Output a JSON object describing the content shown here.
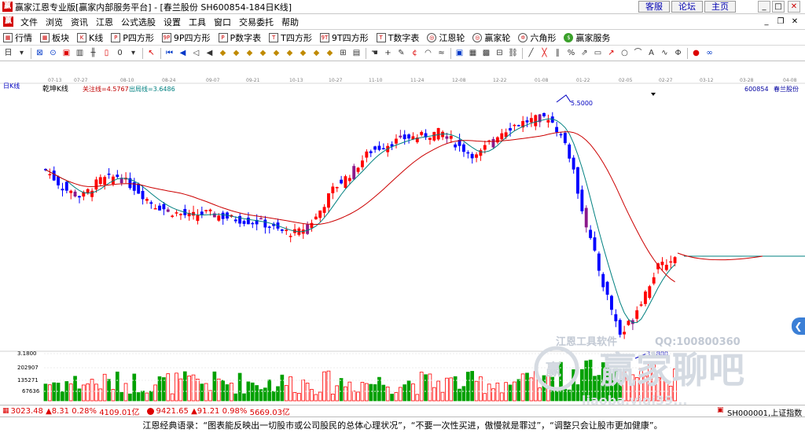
{
  "window": {
    "app_icon": "赢",
    "title": "赢家江恩专业版[赢家内部服务平台] - [春兰股份  SH600854-184日K线]",
    "links": [
      "客服",
      "论坛",
      "主页"
    ],
    "controls": [
      "minimize-icon",
      "maximize-icon",
      "close-icon"
    ]
  },
  "menubar": {
    "logo": "赢",
    "items": [
      "文件",
      "浏览",
      "资讯",
      "江恩",
      "公式选股",
      "设置",
      "工具",
      "窗口",
      "交易委托",
      "帮助"
    ],
    "mdi_controls": [
      "minimize-icon",
      "restore-icon",
      "close-icon"
    ]
  },
  "toolbar1": {
    "items": [
      {
        "label": "行情",
        "icon": "grid-icon",
        "ico": "▦"
      },
      {
        "label": "板块",
        "icon": "blocks-icon",
        "ico": "▦"
      },
      {
        "label": "K线",
        "icon": "candlestick-icon",
        "ico": "K"
      },
      {
        "label": "P四方形",
        "icon": "p-square-icon",
        "ico": "P"
      },
      {
        "label": "9P四方形",
        "icon": "9p-square-icon",
        "ico": "9P"
      },
      {
        "label": "P数字表",
        "icon": "p-number-table-icon",
        "ico": "P"
      },
      {
        "label": "T四方形",
        "icon": "t-square-icon",
        "ico": "T"
      },
      {
        "label": "9T四方形",
        "icon": "9t-square-icon",
        "ico": "9T"
      },
      {
        "label": "T数字表",
        "icon": "t-number-table-icon",
        "ico": "T"
      },
      {
        "label": "江恩轮",
        "icon": "gann-wheel-icon",
        "ico": "◎"
      },
      {
        "label": "赢家轮",
        "icon": "winner-wheel-icon",
        "ico": "◎"
      },
      {
        "label": "六角形",
        "icon": "hexagon-icon",
        "ico": "✡"
      },
      {
        "label": "赢家服务",
        "icon": "dollar-icon",
        "ico": "$"
      }
    ]
  },
  "toolbar2": {
    "icons": [
      {
        "name": "period-icon",
        "glyph": "日",
        "color": ""
      },
      {
        "name": "dropdown-icon",
        "glyph": "▾",
        "color": ""
      },
      {
        "name": "sep",
        "glyph": "",
        "color": ""
      },
      {
        "name": "diamond-icon",
        "glyph": "⊠",
        "color": "blue"
      },
      {
        "name": "circle-icon",
        "glyph": "⊙",
        "color": "blue"
      },
      {
        "name": "square-icon",
        "glyph": "▣",
        "color": "red"
      },
      {
        "name": "bar-icon",
        "glyph": "▥",
        "color": ""
      },
      {
        "name": "line-icon",
        "glyph": "╫",
        "color": ""
      },
      {
        "name": "candle-icon",
        "glyph": "▯",
        "color": "red"
      },
      {
        "name": "scale-icon",
        "glyph": "0",
        "color": ""
      },
      {
        "name": "dropdown-icon",
        "glyph": "▾",
        "color": ""
      },
      {
        "name": "sep",
        "glyph": "",
        "color": ""
      },
      {
        "name": "cursor-icon",
        "glyph": "↖",
        "color": "red"
      },
      {
        "name": "sep",
        "glyph": "",
        "color": ""
      },
      {
        "name": "first-icon",
        "glyph": "⏮",
        "color": "blue"
      },
      {
        "name": "prev-icon",
        "glyph": "◀",
        "color": "blue"
      },
      {
        "name": "step-icon",
        "glyph": "◁",
        "color": ""
      },
      {
        "name": "back-icon",
        "glyph": "◀",
        "color": ""
      },
      {
        "name": "gann-angle-icon",
        "glyph": "◆",
        "color": "gold"
      },
      {
        "name": "gann-box-icon",
        "glyph": "◆",
        "color": "gold"
      },
      {
        "name": "gann-fan-icon",
        "glyph": "◆",
        "color": "gold"
      },
      {
        "name": "gann-grid-icon",
        "glyph": "◆",
        "color": "gold"
      },
      {
        "name": "gann-square-icon",
        "glyph": "◆",
        "color": "gold"
      },
      {
        "name": "gann-line-icon",
        "glyph": "◆",
        "color": "gold"
      },
      {
        "name": "gann-arc-icon",
        "glyph": "◆",
        "color": "gold"
      },
      {
        "name": "fib-icon",
        "glyph": "◆",
        "color": "gold"
      },
      {
        "name": "cycle-icon",
        "glyph": "◆",
        "color": "gold"
      },
      {
        "name": "ruler-icon",
        "glyph": "⊞",
        "color": ""
      },
      {
        "name": "table-icon",
        "glyph": "▤",
        "color": ""
      },
      {
        "name": "sep",
        "glyph": "",
        "color": ""
      },
      {
        "name": "hand-icon",
        "glyph": "☚",
        "color": ""
      },
      {
        "name": "plus-icon",
        "glyph": "+",
        "color": ""
      },
      {
        "name": "pen-icon",
        "glyph": "✎",
        "color": ""
      },
      {
        "name": "calc-icon",
        "glyph": "¢",
        "color": "red"
      },
      {
        "name": "arc-icon",
        "glyph": "◠",
        "color": ""
      },
      {
        "name": "wave-icon",
        "glyph": "≈",
        "color": ""
      },
      {
        "name": "sep",
        "glyph": "",
        "color": ""
      },
      {
        "name": "window-icon",
        "glyph": "▣",
        "color": "blue"
      },
      {
        "name": "save-icon",
        "glyph": "▦",
        "color": ""
      },
      {
        "name": "print-icon",
        "glyph": "▩",
        "color": ""
      },
      {
        "name": "compare-icon",
        "glyph": "⊟",
        "color": ""
      },
      {
        "name": "link-icon",
        "glyph": "⛓",
        "color": ""
      },
      {
        "name": "sep",
        "glyph": "",
        "color": ""
      },
      {
        "name": "draw-line-icon",
        "glyph": "╱",
        "color": ""
      },
      {
        "name": "draw-polyline-icon",
        "glyph": "╳",
        "color": "red"
      },
      {
        "name": "draw-parallel-icon",
        "glyph": "∥",
        "color": ""
      },
      {
        "name": "percent-icon",
        "glyph": "%",
        "color": ""
      },
      {
        "name": "draw-channel-icon",
        "glyph": "⇗",
        "color": ""
      },
      {
        "name": "draw-rect-icon",
        "glyph": "▭",
        "color": ""
      },
      {
        "name": "draw-arrow-icon",
        "glyph": "↗",
        "color": "red"
      },
      {
        "name": "draw-circle-icon",
        "glyph": "○",
        "color": ""
      },
      {
        "name": "draw-fan-icon",
        "glyph": "⌒",
        "color": ""
      },
      {
        "name": "draw-text-icon",
        "glyph": "A",
        "color": ""
      },
      {
        "name": "draw-cycle-icon",
        "glyph": "∿",
        "color": ""
      },
      {
        "name": "draw-golden-icon",
        "glyph": "Φ",
        "color": ""
      },
      {
        "name": "sep",
        "glyph": "",
        "color": ""
      },
      {
        "name": "chart-color-icon",
        "glyph": "●",
        "color": "red"
      },
      {
        "name": "infinity-icon",
        "glyph": "∞",
        "color": "blue"
      }
    ]
  },
  "chart": {
    "period_label": "日K线",
    "indicator_name": "乾坤K线",
    "line1": "关注线=4.5767",
    "line2": "出局线=3.6486",
    "stock_code": "600854",
    "stock_name": "春兰股份",
    "dates": [
      "07-13",
      "07-27",
      "08-10",
      "08-24",
      "09-07",
      "09-21",
      "10-13",
      "10-27",
      "11-10",
      "11-24",
      "12-08",
      "12-22",
      "01-08",
      "01-22",
      "02-05",
      "02-27",
      "03-12",
      "03-28",
      "04-08"
    ],
    "high_label": "5.5000",
    "low_label": "3.1800",
    "volume_axis": [
      "3.1800",
      "202907",
      "135271",
      "67636"
    ],
    "watermark_line1": "江恩工具软件",
    "watermark_qq": "QQ:100800360",
    "watermark_logo": "赢",
    "watermark_brand": "赢家聊吧",
    "watermark_url": "liaoba.yjgi39..."
  },
  "statusbar": {
    "sh_index": "3023.48",
    "sh_change": "▲8.31",
    "sh_pct": "0.28%",
    "sh_amount": "4109.01亿",
    "sz_index": "9421.65",
    "sz_change": "▲91.21",
    "sz_pct": "0.98%",
    "sz_amount": "5669.03亿",
    "current_index": "SH000001,上证指数"
  },
  "quote": "江恩经典语录：“图表能反映出一切股市或公司股民的总体心理状况”，“不要一次性买进，傲慢就是罪过”，“调整只会让股市更加健康”。",
  "colors": {
    "up": "#ff0000",
    "down": "#0000ff",
    "purple": "#8b1a8b",
    "ma_fast": "#008080",
    "ma_slow": "#cc0000",
    "vol_up": "#ff0000",
    "vol_down": "#00a000"
  },
  "chart_data": {
    "type": "candlestick",
    "title": "春兰股份 SH600854-184日K线",
    "x": [
      "07-13",
      "07-27",
      "08-10",
      "08-24",
      "09-07",
      "09-21",
      "10-13",
      "10-27",
      "11-10",
      "11-24",
      "12-08",
      "12-22",
      "01-08",
      "01-22",
      "02-05",
      "02-27",
      "03-12",
      "03-28",
      "04-08"
    ],
    "annotations": [
      {
        "label": "5.5000",
        "type": "high"
      },
      {
        "label": "3.1800",
        "type": "low"
      }
    ],
    "series": [
      {
        "name": "关注线",
        "last_value": 4.5767
      },
      {
        "name": "出局线",
        "last_value": 3.6486
      }
    ],
    "close_path": [
      4.88,
      4.7,
      4.62,
      4.78,
      4.82,
      4.7,
      4.55,
      4.48,
      4.44,
      4.47,
      4.43,
      4.4,
      4.38,
      4.3,
      4.28,
      4.42,
      4.7,
      4.85,
      5.05,
      5.12,
      5.18,
      5.2,
      5.24,
      5.1,
      5.0,
      5.2,
      5.3,
      5.35,
      5.38,
      5.1,
      4.4,
      3.8,
      3.3,
      3.6,
      3.95,
      4.05
    ],
    "volume_ylim_labels": [
      "202907",
      "135271",
      "67636"
    ]
  }
}
